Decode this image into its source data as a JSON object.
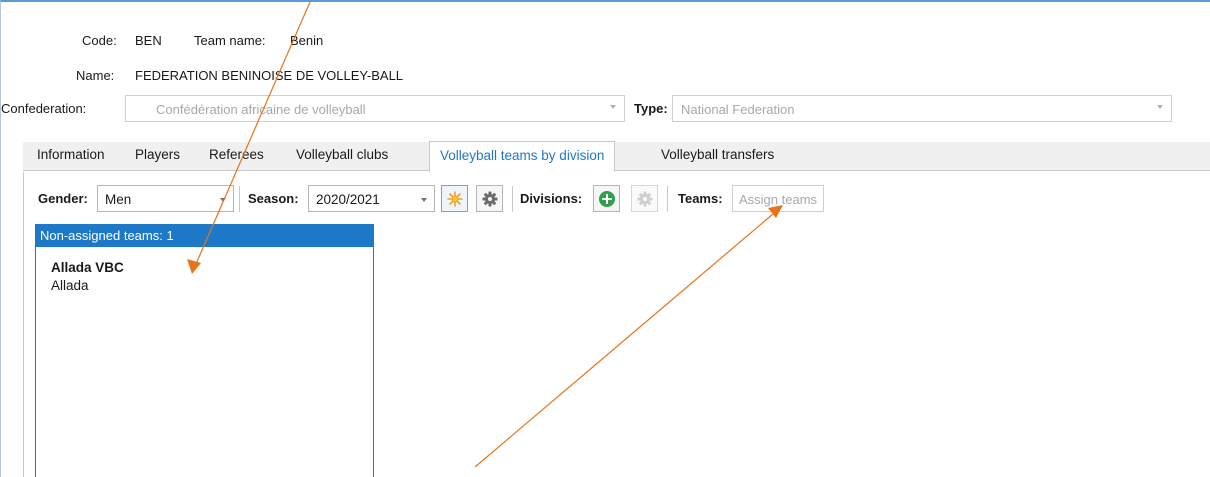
{
  "header": {
    "code_label": "Code:",
    "code_value": "BEN",
    "team_name_label": "Team name:",
    "team_name_value": "Benin",
    "name_label": "Name:",
    "name_value": "FEDERATION BENINOISE DE VOLLEY-BALL",
    "confederation_label": "Confederation:",
    "confederation_value": "Confédération africaine de volleyball",
    "type_label": "Type:",
    "type_value": "National Federation"
  },
  "tabs": [
    {
      "label": "Information",
      "active": false
    },
    {
      "label": "Players",
      "active": false
    },
    {
      "label": "Referees",
      "active": false
    },
    {
      "label": "Volleyball clubs",
      "active": false
    },
    {
      "label": "Volleyball teams by division",
      "active": true
    },
    {
      "label": "Volleyball transfers",
      "active": false
    }
  ],
  "toolbar": {
    "gender_label": "Gender:",
    "gender_value": "Men",
    "season_label": "Season:",
    "season_value": "2020/2021",
    "new_season_icon": "sun-icon",
    "season_settings_icon": "gear-icon",
    "divisions_label": "Divisions:",
    "add_division_icon": "plus-circle-icon",
    "division_settings_icon": "gear-icon",
    "teams_label": "Teams:",
    "assign_teams_label": "Assign teams"
  },
  "panel": {
    "header": "Non-assigned teams: 1",
    "items": [
      {
        "name": "Allada VBC",
        "city": "Allada"
      }
    ]
  },
  "colors": {
    "accent": "#1e78c8",
    "annotation_arrow": "#e8731a",
    "add_green": "#2e9e4f",
    "sun_orange": "#f0a020"
  }
}
